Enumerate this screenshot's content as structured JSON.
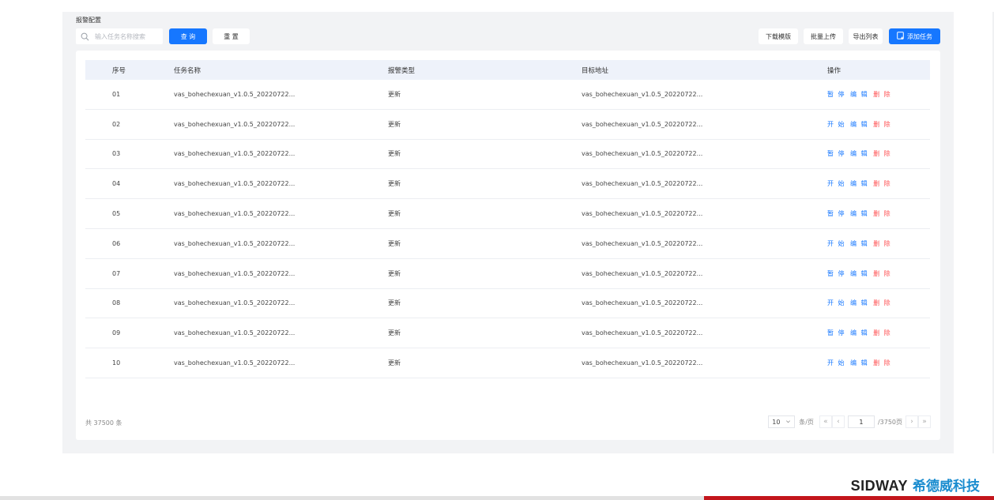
{
  "panel": {
    "title": "报警配置"
  },
  "search": {
    "placeholder": "输入任务名称搜索",
    "value": ""
  },
  "toolbar": {
    "query_label": "查 询",
    "reset_label": "重 置",
    "download_label": "下载模版",
    "upload_label": "批量上传",
    "export_label": "导出列表",
    "add_label": "添加任务"
  },
  "table": {
    "headers": {
      "idx": "序号",
      "name": "任务名称",
      "type": "报警类型",
      "url": "目标地址",
      "ops": "操作"
    },
    "rows": [
      {
        "idx": "01",
        "name": "vas_bohechexuan_v1.0.5_20220722...",
        "type": "更新",
        "url": "vas_bohechexuan_v1.0.5_20220722...",
        "toggle": "暂 停",
        "edit": "编 辑",
        "delete": "删 除"
      },
      {
        "idx": "02",
        "name": "vas_bohechexuan_v1.0.5_20220722...",
        "type": "更新",
        "url": "vas_bohechexuan_v1.0.5_20220722...",
        "toggle": "开 始",
        "edit": "编 辑",
        "delete": "删 除"
      },
      {
        "idx": "03",
        "name": "vas_bohechexuan_v1.0.5_20220722...",
        "type": "更新",
        "url": "vas_bohechexuan_v1.0.5_20220722...",
        "toggle": "暂 停",
        "edit": "编 辑",
        "delete": "删 除"
      },
      {
        "idx": "04",
        "name": "vas_bohechexuan_v1.0.5_20220722...",
        "type": "更新",
        "url": "vas_bohechexuan_v1.0.5_20220722...",
        "toggle": "开 始",
        "edit": "编 辑",
        "delete": "删 除"
      },
      {
        "idx": "05",
        "name": "vas_bohechexuan_v1.0.5_20220722...",
        "type": "更新",
        "url": "vas_bohechexuan_v1.0.5_20220722...",
        "toggle": "暂 停",
        "edit": "编 辑",
        "delete": "删 除"
      },
      {
        "idx": "06",
        "name": "vas_bohechexuan_v1.0.5_20220722...",
        "type": "更新",
        "url": "vas_bohechexuan_v1.0.5_20220722...",
        "toggle": "开 始",
        "edit": "编 辑",
        "delete": "删 除"
      },
      {
        "idx": "07",
        "name": "vas_bohechexuan_v1.0.5_20220722...",
        "type": "更新",
        "url": "vas_bohechexuan_v1.0.5_20220722...",
        "toggle": "暂 停",
        "edit": "编 辑",
        "delete": "删 除"
      },
      {
        "idx": "08",
        "name": "vas_bohechexuan_v1.0.5_20220722...",
        "type": "更新",
        "url": "vas_bohechexuan_v1.0.5_20220722...",
        "toggle": "开 始",
        "edit": "编 辑",
        "delete": "删 除"
      },
      {
        "idx": "09",
        "name": "vas_bohechexuan_v1.0.5_20220722...",
        "type": "更新",
        "url": "vas_bohechexuan_v1.0.5_20220722...",
        "toggle": "暂 停",
        "edit": "编 辑",
        "delete": "删 除"
      },
      {
        "idx": "10",
        "name": "vas_bohechexuan_v1.0.5_20220722...",
        "type": "更新",
        "url": "vas_bohechexuan_v1.0.5_20220722...",
        "toggle": "开 始",
        "edit": "编 辑",
        "delete": "删 除"
      }
    ]
  },
  "pagination": {
    "total_text": "共 37500 条",
    "page_size": "10",
    "page_size_unit": "条/页",
    "current_page": "1",
    "total_pages": "/3750页",
    "first_glyph": "«",
    "prev_glyph": "‹",
    "next_glyph": "›",
    "last_glyph": "»"
  },
  "brand": {
    "name_en": "SIDWAY",
    "name_cn": "希德威科技"
  },
  "colors": {
    "primary": "#1677ff",
    "danger": "#ff4d4f",
    "brand_blue": "#1a8ccf",
    "brand_red": "#c3161c"
  },
  "icons": {
    "search": "search-icon",
    "add": "add-task-icon",
    "page_size_dropdown": "chevron-down-icon"
  }
}
